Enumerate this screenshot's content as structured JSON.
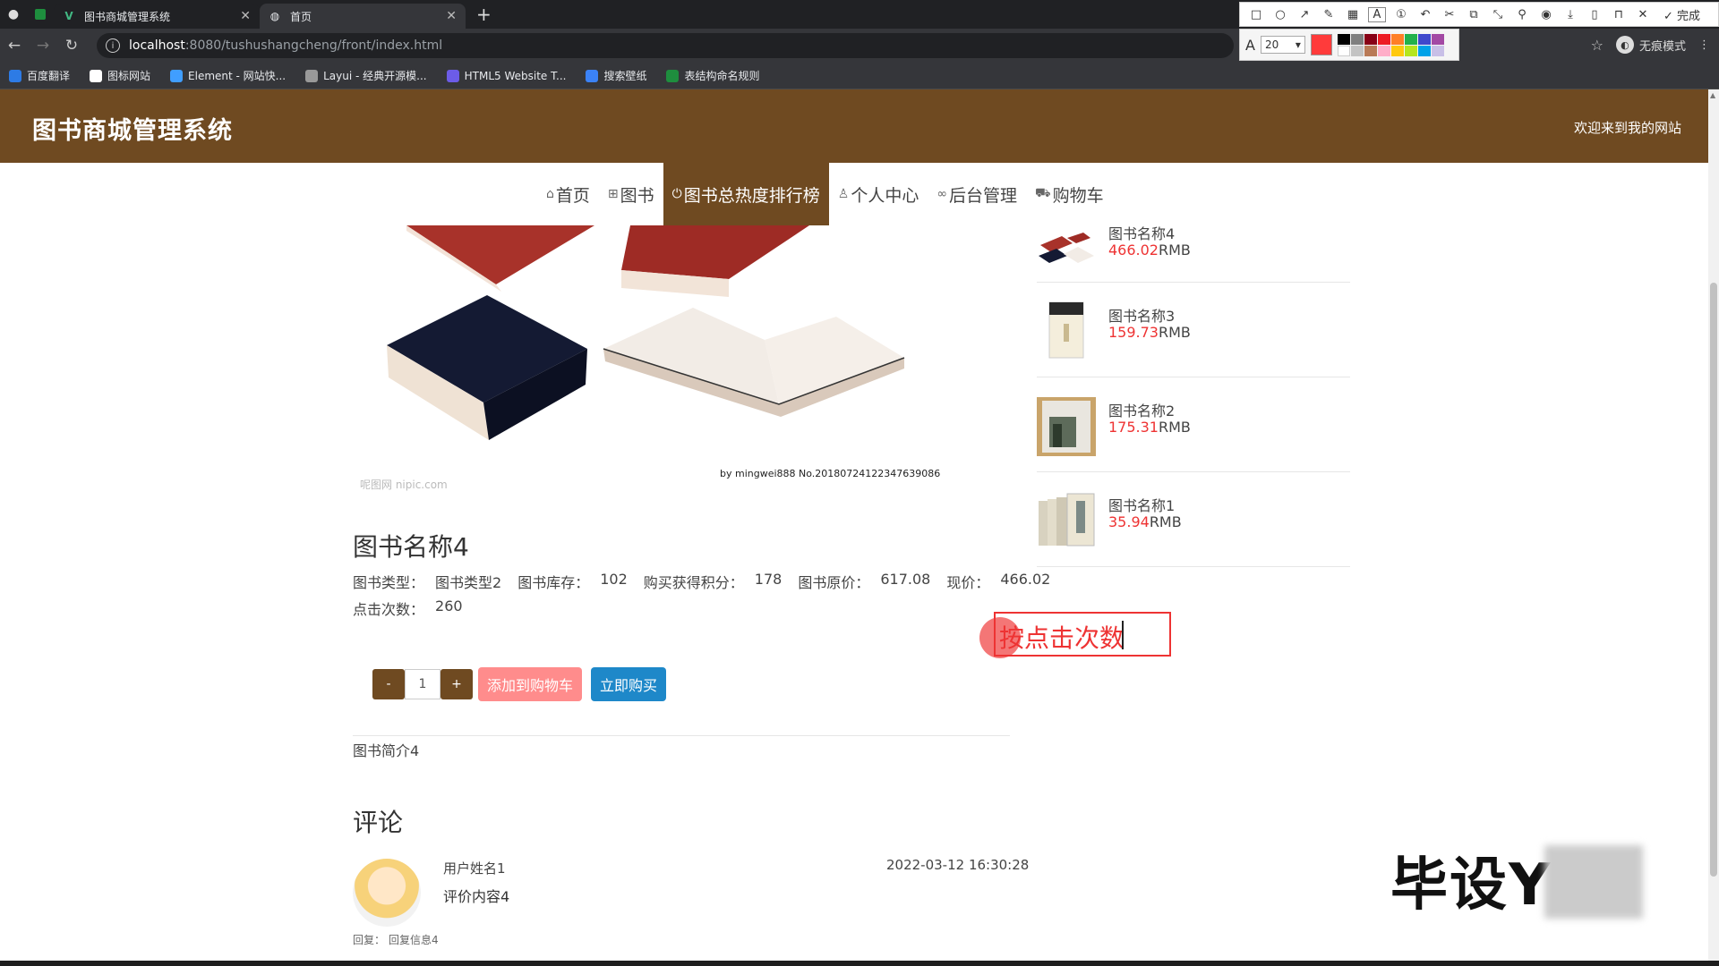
{
  "browser": {
    "tabs": [
      {
        "title": "图书商城管理系统",
        "active": false
      },
      {
        "title": "首页",
        "active": true
      }
    ],
    "url_host": "localhost",
    "url_path": ":8080/tushushangcheng/front/index.html",
    "incognito_label": "无痕模式",
    "bookmarks": [
      "百度翻译",
      "图标网站",
      "Element - 网站快...",
      "Layui - 经典开源模...",
      "HTML5 Website T...",
      "搜索壁纸",
      "表结构命名规则"
    ]
  },
  "annotation_tool": {
    "done_label": "完成",
    "font_size": "20",
    "colors": {
      "selected": "#ff3b3b"
    }
  },
  "header": {
    "site_title": "图书商城管理系统",
    "welcome": "欢迎来到我的网站"
  },
  "nav": {
    "items": [
      {
        "label": "首页",
        "icon": "home-icon"
      },
      {
        "label": "图书",
        "icon": "grid-icon"
      },
      {
        "label": "图书总热度排行榜",
        "icon": "power-icon",
        "active": true
      },
      {
        "label": "个人中心",
        "icon": "user-icon"
      },
      {
        "label": "后台管理",
        "icon": "link-icon"
      },
      {
        "label": "购物车",
        "icon": "cart-icon"
      }
    ]
  },
  "product": {
    "image_watermark_left": "呢图网 nipic.com",
    "image_watermark_right": "by mingwei888 No.20180724122347639086",
    "title": "图书名称4",
    "type_label": "图书类型：",
    "type_value": "图书类型2",
    "stock_label": "图书库存：",
    "stock_value": "102",
    "points_label": "购买获得积分：",
    "points_value": "178",
    "orig_price_label": "图书原价：",
    "orig_price_value": "617.08",
    "price_label": "现价：",
    "price_value": "466.02",
    "clicks_label": "点击次数：",
    "clicks_value": "260",
    "qty_minus": "-",
    "qty_value": "1",
    "qty_plus": "+",
    "add_to_cart": "添加到购物车",
    "buy_now": "立即购买",
    "description": "图书简介4"
  },
  "comments": {
    "heading": "评论",
    "items": [
      {
        "user": "用户姓名1",
        "content": "评价内容4",
        "time": "2022-03-12 16:30:28",
        "reply_label": "回复：",
        "reply": "回复信息4"
      }
    ]
  },
  "ranking": {
    "currency": "RMB",
    "items": [
      {
        "name": "图书名称4",
        "price": "466.02"
      },
      {
        "name": "图书名称3",
        "price": "159.73"
      },
      {
        "name": "图书名称2",
        "price": "175.31"
      },
      {
        "name": "图书名称1",
        "price": "35.94"
      }
    ]
  },
  "overlay": {
    "annotation_text": "按点击次数",
    "watermark": "毕设Y"
  }
}
